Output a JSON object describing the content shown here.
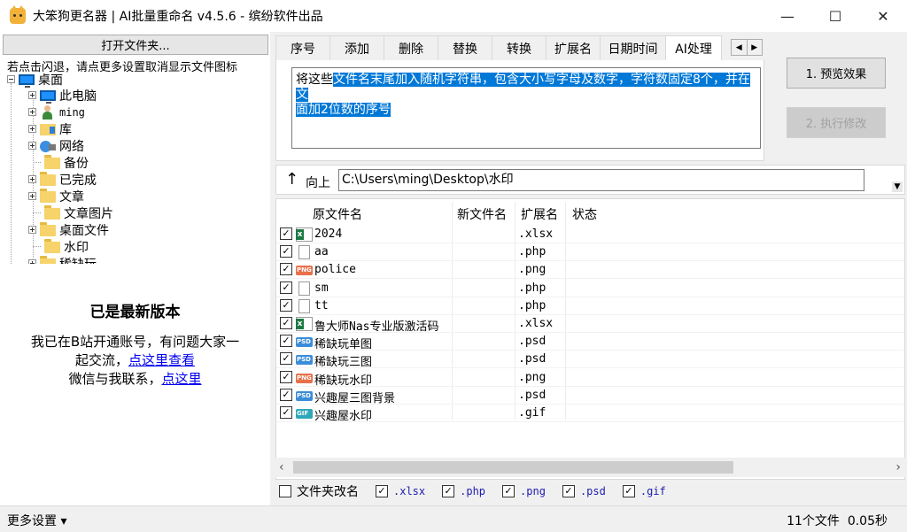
{
  "window": {
    "title": "大笨狗更名器 | AI批量重命名 v4.5.6 - 缤纷软件出品",
    "controls": {
      "minimize": "—",
      "maximize": "☐",
      "close": "✕"
    }
  },
  "left": {
    "open_folder_label": "打开文件夹...",
    "hint": "若点击闪退，请点更多设置取消显示文件图标",
    "tree": {
      "root": "桌面",
      "items": [
        {
          "label": "此电脑",
          "icon": "monitor-icon"
        },
        {
          "label": "ming",
          "icon": "user-icon"
        },
        {
          "label": "库",
          "icon": "library-icon"
        },
        {
          "label": "网络",
          "icon": "network-icon"
        },
        {
          "label": "备份",
          "icon": "folder-icon"
        },
        {
          "label": "已完成",
          "icon": "folder-icon"
        },
        {
          "label": "文章",
          "icon": "folder-icon"
        },
        {
          "label": "文章图片",
          "icon": "folder-icon"
        },
        {
          "label": "桌面文件",
          "icon": "folder-icon"
        },
        {
          "label": "水印",
          "icon": "folder-icon"
        },
        {
          "label": "稀缺玩",
          "icon": "folder-icon"
        }
      ]
    },
    "latest_version": "已是最新版本",
    "contact_line1": "我已在B站开通账号，有问题大家一",
    "contact_line2_prefix": "起交流，",
    "contact_link1": "点这里查看",
    "contact_line3_prefix": "微信与我联系，",
    "contact_link2": "点这里"
  },
  "tabs": [
    "序号",
    "添加",
    "删除",
    "替换",
    "转换",
    "扩展名",
    "日期时间",
    "AI处理"
  ],
  "active_tab": "AI处理",
  "ai_prompt": {
    "plain": "将这些",
    "selected_line1": "文件名末尾加入随机字符串，包含大小写字母及数字，字符数固定8个，并在文",
    "selected_line2": "面加2位数的序号"
  },
  "buttons": {
    "preview": "1. 预览效果",
    "execute": "2. 执行修改"
  },
  "path": {
    "up_label": "向上",
    "value": "C:\\Users\\ming\\Desktop\\水印"
  },
  "columns": {
    "original": "原文件名",
    "new": "新文件名",
    "ext": "扩展名",
    "status": "状态"
  },
  "files": [
    {
      "name": "2024",
      "ext": ".xlsx",
      "type": "xlsx",
      "checked": true
    },
    {
      "name": "aa",
      "ext": ".php",
      "type": "doc",
      "checked": true
    },
    {
      "name": "police",
      "ext": ".png",
      "type": "png",
      "checked": true
    },
    {
      "name": "sm",
      "ext": ".php",
      "type": "doc",
      "checked": true
    },
    {
      "name": "tt",
      "ext": ".php",
      "type": "doc",
      "checked": true
    },
    {
      "name": "鲁大师Nas专业版激活码",
      "ext": ".xlsx",
      "type": "xlsx",
      "checked": true
    },
    {
      "name": "稀缺玩单图",
      "ext": ".psd",
      "type": "psd",
      "checked": true
    },
    {
      "name": "稀缺玩三图",
      "ext": ".psd",
      "type": "psd",
      "checked": true
    },
    {
      "name": "稀缺玩水印",
      "ext": ".png",
      "type": "png",
      "checked": true
    },
    {
      "name": "兴趣屋三图背景",
      "ext": ".psd",
      "type": "psd",
      "checked": true
    },
    {
      "name": "兴趣屋水印",
      "ext": ".gif",
      "type": "gif",
      "checked": true
    }
  ],
  "filters": {
    "folder_rename": "文件夹改名",
    "folder_rename_checked": false,
    "exts": [
      {
        "ext": ".xlsx",
        "checked": true
      },
      {
        "ext": ".php",
        "checked": true
      },
      {
        "ext": ".png",
        "checked": true
      },
      {
        "ext": ".psd",
        "checked": true
      },
      {
        "ext": ".gif",
        "checked": true
      }
    ]
  },
  "status": {
    "more_settings": "更多设置 ▾",
    "file_count": "11个文件",
    "elapsed": "0.05秒"
  },
  "colors": {
    "selection": "#0078d7",
    "link": "#0000ee"
  }
}
